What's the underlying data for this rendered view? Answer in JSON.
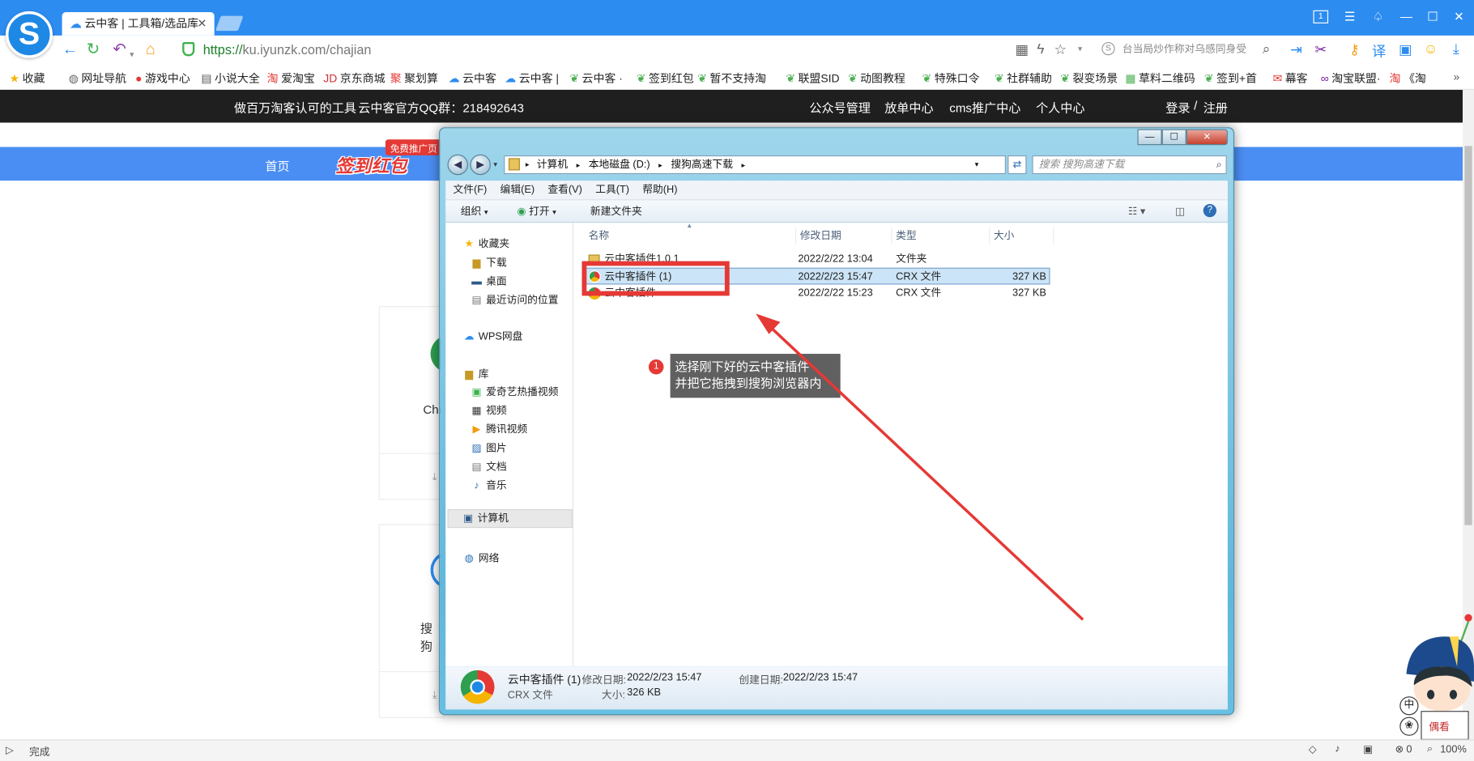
{
  "browser": {
    "tab_title": "云中客 | 工具箱/选品库",
    "url_https": "https://",
    "url_rest": "ku.iyunzk.com/chajian",
    "search_placeholder": "台当局炒作称对乌感同身受",
    "tab_count": "1"
  },
  "bookmarks": [
    {
      "label": "收藏",
      "icon": "star-icon",
      "color": "#f5b400"
    },
    {
      "label": "网址导航",
      "icon": "globe-icon",
      "color": "#666666"
    },
    {
      "label": "游戏中心",
      "icon": "game-icon",
      "color": "#e53935"
    },
    {
      "label": "小说大全",
      "icon": "book-icon",
      "color": "#555555"
    },
    {
      "label": "爱淘宝",
      "icon": "taobao-icon",
      "color": "#e53935"
    },
    {
      "label": "京东商城",
      "icon": "jd-icon",
      "color": "#d32f2f"
    },
    {
      "label": "聚划算",
      "icon": "juhuasuan-icon",
      "color": "#e53935"
    },
    {
      "label": "云中客",
      "icon": "cloud-icon",
      "color": "#2d8cf0"
    },
    {
      "label": "云中客 |",
      "icon": "cloud-icon",
      "color": "#2d8cf0"
    },
    {
      "label": "云中客 ·",
      "icon": "leaf-icon",
      "color": "#4caf50"
    },
    {
      "label": "签到红包",
      "icon": "leaf-icon",
      "color": "#4caf50"
    },
    {
      "label": "暂不支持淘",
      "icon": "leaf-icon",
      "color": "#4caf50"
    },
    {
      "label": "联盟SID",
      "icon": "leaf-icon",
      "color": "#4caf50"
    },
    {
      "label": "动图教程",
      "icon": "leaf-icon",
      "color": "#4caf50"
    },
    {
      "label": "特殊口令",
      "icon": "leaf-icon",
      "color": "#4caf50"
    },
    {
      "label": "社群辅助",
      "icon": "leaf-icon",
      "color": "#4caf50"
    },
    {
      "label": "裂变场景",
      "icon": "leaf-icon",
      "color": "#4caf50"
    },
    {
      "label": "草料二维码",
      "icon": "qrcode-icon",
      "color": "#4caf50"
    },
    {
      "label": "签到+首",
      "icon": "leaf-icon",
      "color": "#4caf50"
    },
    {
      "label": "幕客",
      "icon": "mail-icon",
      "color": "#e53935"
    },
    {
      "label": "淘宝联盟·",
      "icon": "alimama-icon",
      "color": "#7b1fa2"
    },
    {
      "label": "《淘",
      "icon": "taobao-icon",
      "color": "#e53935"
    }
  ],
  "site": {
    "slogan": "做百万淘客认可的工具",
    "qq_group": "云中客官方QQ群：218492643",
    "nav": [
      "公众号管理",
      "放单中心",
      "cms推广中心",
      "个人中心"
    ],
    "login": "登录",
    "separator": "/",
    "register": "注册",
    "home": "首页",
    "hongbao": "签到红包",
    "free_badge": "免费推广页",
    "card1_label": "Chr",
    "card2_label": "搜狗"
  },
  "explorer": {
    "breadcrumb": [
      "计算机",
      "本地磁盘 (D:)",
      "搜狗高速下载"
    ],
    "search_placeholder": "搜索 搜狗高速下载",
    "menu": [
      "文件(F)",
      "编辑(E)",
      "查看(V)",
      "工具(T)",
      "帮助(H)"
    ],
    "commands": {
      "organize": "组织",
      "open": "打开",
      "new_folder": "新建文件夹"
    },
    "nav_pane": {
      "favorites": "收藏夹",
      "fav_items": [
        "下载",
        "桌面",
        "最近访问的位置"
      ],
      "wps": "WPS网盘",
      "library": "库",
      "lib_items": [
        "爱奇艺热播视频",
        "视频",
        "腾讯视频",
        "图片",
        "文档",
        "音乐"
      ],
      "computer": "计算机",
      "network": "网络"
    },
    "columns": [
      "名称",
      "修改日期",
      "类型",
      "大小"
    ],
    "files": [
      {
        "name": "云中客插件1.0.1",
        "date": "2022/2/22 13:04",
        "type": "文件夹",
        "size": ""
      },
      {
        "name": "云中客插件 (1)",
        "date": "2022/2/23 15:47",
        "type": "CRX 文件",
        "size": "327 KB"
      },
      {
        "name": "云中客插件",
        "date": "2022/2/22 15:23",
        "type": "CRX 文件",
        "size": "327 KB"
      }
    ],
    "details": {
      "name": "云中客插件 (1)",
      "type": "CRX 文件",
      "modified_label": "修改日期:",
      "modified": "2022/2/23 15:47",
      "created_label": "创建日期:",
      "created": "2022/2/23 15:47",
      "size_label": "大小:",
      "size": "326 KB"
    }
  },
  "annotation": {
    "step": "1",
    "line1": "选择刚下好的云中客插件",
    "line2": "并把它拖拽到搜狗浏览器内",
    "color": "#e53935"
  },
  "status": {
    "text": "完成",
    "count": "0",
    "zoom": "100%"
  },
  "mascot": {
    "ime": "中"
  }
}
